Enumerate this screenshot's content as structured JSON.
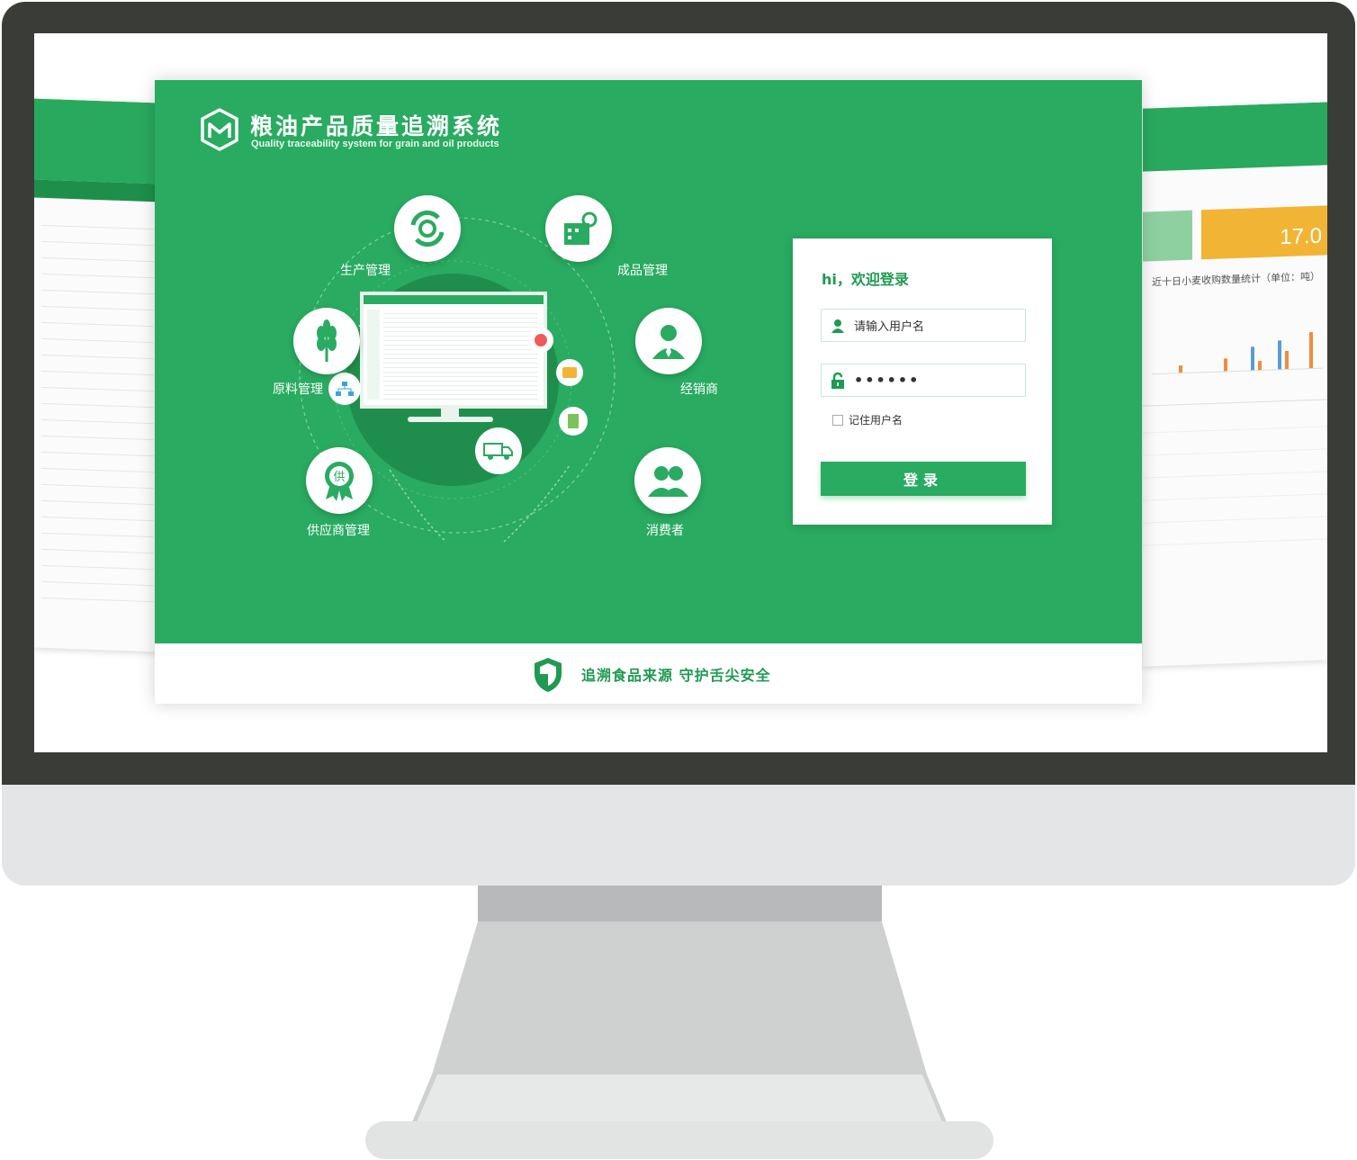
{
  "app": {
    "title_cn": "粮油产品质量追溯系统",
    "title_en": "Quality traceability system for grain and oil products"
  },
  "diagram": {
    "nodes": [
      {
        "label": "生产管理",
        "icon": "production-cycle-icon"
      },
      {
        "label": "成品管理",
        "icon": "factory-gear-icon"
      },
      {
        "label": "原料管理",
        "icon": "wheat-icon"
      },
      {
        "label": "经销商",
        "icon": "businessman-icon"
      },
      {
        "label": "供应商管理",
        "icon": "supplier-badge-icon"
      },
      {
        "label": "消费者",
        "icon": "users-group-icon"
      }
    ],
    "supplier_glyph": "供"
  },
  "login": {
    "title": "hi，欢迎登录",
    "username_placeholder": "请输入用户名",
    "password_value": "••••••",
    "remember_label": "记住用户名",
    "submit_label": "登录"
  },
  "footer": {
    "slogan": "追溯食品来源  守护舌尖安全"
  },
  "background_panels": {
    "right_stat_value": "17.0",
    "right_chart_title": "近十日小麦收购数量统计（单位：吨）"
  },
  "colors": {
    "brand_green": "#29ab61",
    "dark_green": "#1d8f4b",
    "monitor_bezel": "#3a3c38",
    "monitor_stand": "#e2e3e3",
    "accent_orange": "#f1b434"
  }
}
